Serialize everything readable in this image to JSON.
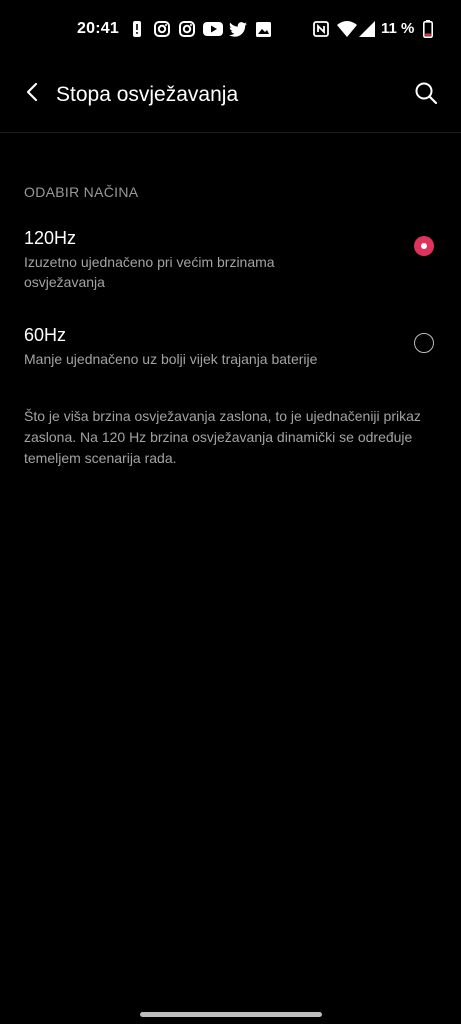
{
  "status_bar": {
    "time": "20:41",
    "battery_percent": "11 %",
    "icons": [
      "alert-icon",
      "instagram-icon",
      "instagram-icon",
      "youtube-icon",
      "twitter-icon",
      "gallery-icon",
      "nfc-icon",
      "wifi-icon",
      "signal-icon",
      "battery-icon"
    ]
  },
  "app_bar": {
    "title": "Stopa osvježavanja"
  },
  "section": {
    "header": "ODABIR NAČINA"
  },
  "options": [
    {
      "title": "120Hz",
      "subtitle": "Izuzetno ujednačeno pri većim brzinama osvježavanja",
      "selected": true
    },
    {
      "title": "60Hz",
      "subtitle": "Manje ujednačeno uz bolji vijek trajanja baterije",
      "selected": false
    }
  ],
  "description": "Što je viša brzina osvježavanja zaslona, to je ujednačeniji prikaz zaslona. Na 120 Hz brzina osvježavanja dinamički se određuje temeljem scenarija rada.",
  "colors": {
    "accent": "#e0335c",
    "background": "#000000",
    "secondary_text": "#a3a3a3"
  }
}
